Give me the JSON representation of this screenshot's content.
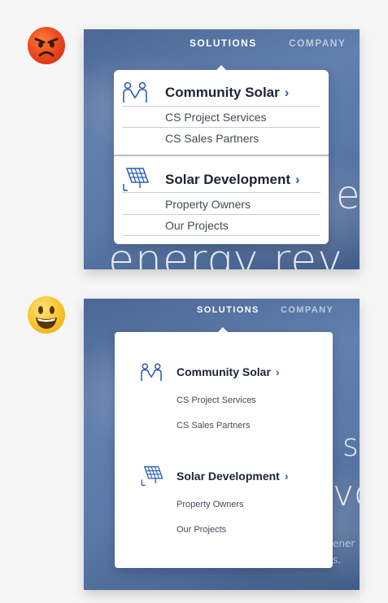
{
  "bad_example": {
    "emoji": "angry-face",
    "nav": {
      "solutions": "SOLUTIONS",
      "company": "COMPANY"
    },
    "hero_text": "energy rev",
    "hero_text_partial": "e",
    "menu": {
      "sections": [
        {
          "title": "Community Solar",
          "icon": "people-icon",
          "chevron": "›",
          "links": [
            "CS Project Services",
            "CS Sales Partners"
          ]
        },
        {
          "title": "Solar Development",
          "icon": "solar-panel-icon",
          "chevron": "›",
          "links": [
            "Property Owners",
            "Our Projects"
          ]
        }
      ]
    }
  },
  "good_example": {
    "emoji": "smiling-face",
    "nav": {
      "solutions": "SOLUTIONS",
      "company": "COMPANY"
    },
    "hero_text_s": "s",
    "hero_text_vo": "vo",
    "hero_small_1": "ener",
    "hero_small_2": "s.",
    "menu": {
      "sections": [
        {
          "title": "Community Solar",
          "icon": "people-icon",
          "chevron": "›",
          "links": [
            "CS Project Services",
            "CS Sales Partners"
          ]
        },
        {
          "title": "Solar Development",
          "icon": "solar-panel-icon",
          "chevron": "›",
          "links": [
            "Property Owners",
            "Our Projects"
          ]
        }
      ]
    }
  },
  "colors": {
    "brand_blue": "#2c5fb4",
    "heading": "#1d2433"
  }
}
